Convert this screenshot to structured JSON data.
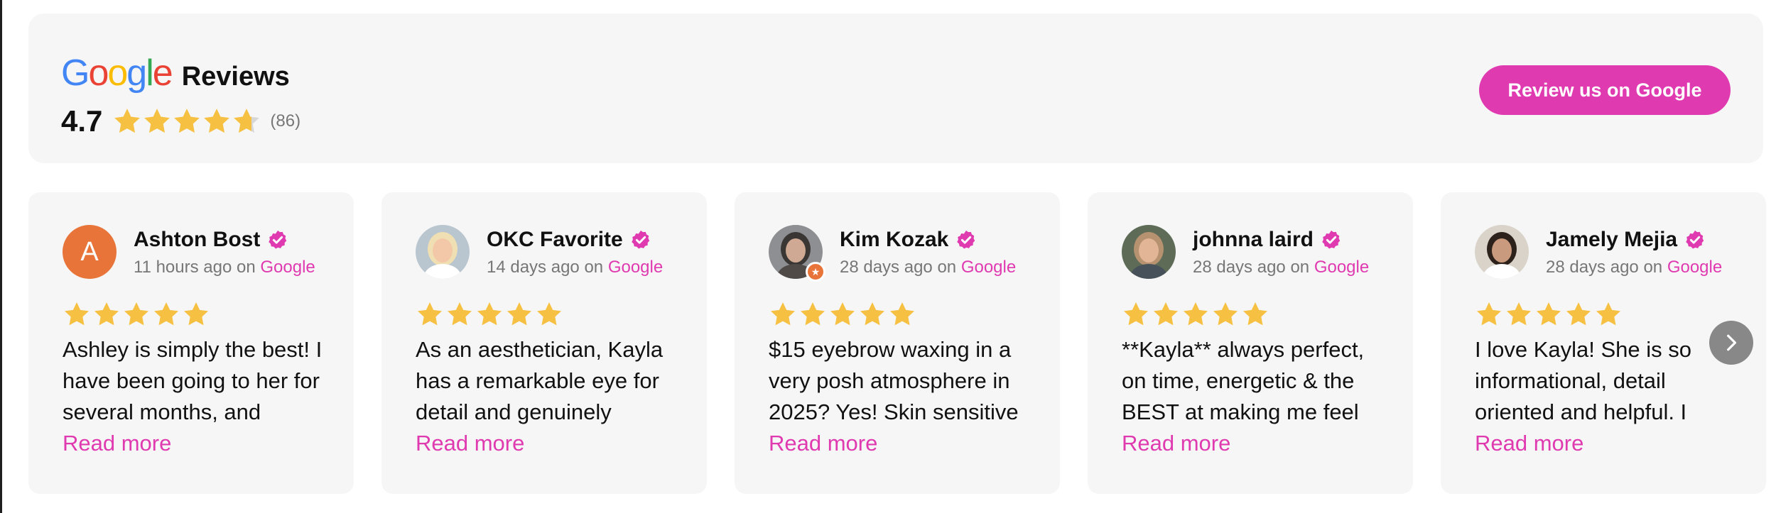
{
  "summary": {
    "logo_text": "Google",
    "title": "Reviews",
    "rating": "4.7",
    "rating_stars": 4.7,
    "review_count": "(86)",
    "button_label": "Review us on Google"
  },
  "colors": {
    "accent": "#e03ab1",
    "star": "#f6c142",
    "star_empty": "#d7d7d7",
    "verified": "#e03ab1",
    "avatar_orange": "#e8743a",
    "next_button": "#888888"
  },
  "reviews": [
    {
      "name": "Ashton Bost",
      "avatar_letter": "A",
      "time": "11 hours ago",
      "on": "on",
      "source": "Google",
      "stars": 5,
      "text": "Ashley is simply the best! I have been going to her for several months, and",
      "read_more": "Read more"
    },
    {
      "name": "OKC Favorite",
      "time": "14 days ago",
      "on": "on",
      "source": "Google",
      "stars": 5,
      "text": "As an aesthetician, Kayla has a remarkable eye for detail and genuinely",
      "read_more": "Read more"
    },
    {
      "name": "Kim Kozak",
      "time": "28 days ago",
      "on": "on",
      "source": "Google",
      "stars": 5,
      "text": "$15 eyebrow waxing in a very posh atmosphere in 2025? Yes! Skin sensitive",
      "read_more": "Read more"
    },
    {
      "name": "johnna laird",
      "time": "28 days ago",
      "on": "on",
      "source": "Google",
      "stars": 5,
      "text": "**Kayla** always perfect, on time, energetic & the BEST at making me feel",
      "read_more": "Read more"
    },
    {
      "name": "Jamely Mejia",
      "time": "28 days ago",
      "on": "on",
      "source": "Google",
      "stars": 5,
      "text": "I love Kayla! She is so informational, detail oriented and helpful. I",
      "read_more": "Read more"
    }
  ]
}
